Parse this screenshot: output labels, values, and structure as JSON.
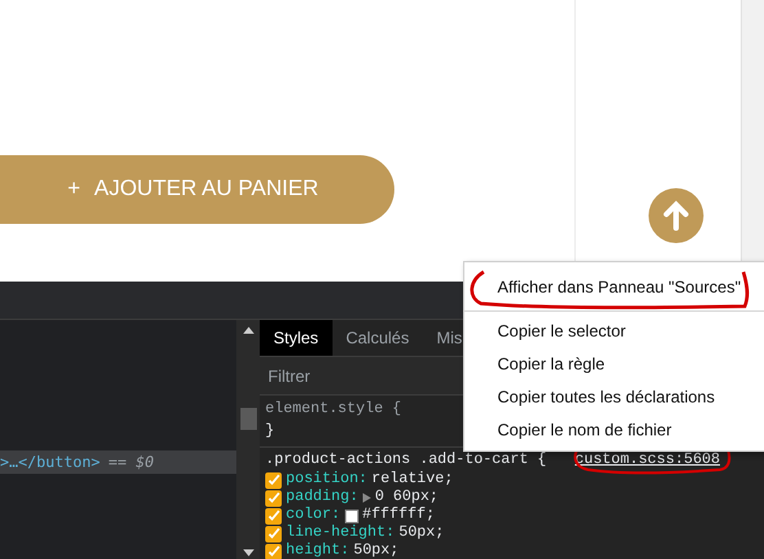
{
  "page": {
    "add_button": {
      "icon": "+",
      "label": "AJOUTER AU PANIER"
    }
  },
  "devtools": {
    "elements": {
      "selected_node": {
        "code": ">…</button>",
        "marker": "== $0"
      }
    },
    "styles_tabs": [
      {
        "label": "Styles",
        "selected": true
      },
      {
        "label": "Calculés",
        "selected": false
      },
      {
        "label": "Mis",
        "selected": false
      }
    ],
    "filter": {
      "placeholder": "Filtrer"
    },
    "rules": [
      {
        "selector": "element.style {",
        "closing": "}"
      },
      {
        "selector": ".product-actions .add-to-cart {",
        "source": "custom.scss:5608",
        "annotated": true,
        "declarations": [
          {
            "property": "position:",
            "value": "relative;",
            "checked": true
          },
          {
            "property": "padding:",
            "value": "0 60px;",
            "checked": true,
            "expandable": true
          },
          {
            "property": "color:",
            "value": "#ffffff;",
            "checked": true,
            "swatch": true
          },
          {
            "property": "line-height:",
            "value": "50px;",
            "checked": true
          },
          {
            "property": "height:",
            "value": "50px;",
            "checked": true
          }
        ]
      }
    ]
  },
  "context_menu": {
    "items": [
      {
        "label": "Afficher dans Panneau \"Sources\"",
        "annotated": true,
        "separator_after": true
      },
      {
        "label": "Copier le selector",
        "annotated": false,
        "separator_after": false
      },
      {
        "label": "Copier la règle",
        "annotated": false,
        "separator_after": false
      },
      {
        "label": "Copier toutes les déclarations",
        "annotated": false,
        "separator_after": false
      },
      {
        "label": "Copier le nom de fichier",
        "annotated": false,
        "separator_after": false
      }
    ]
  }
}
